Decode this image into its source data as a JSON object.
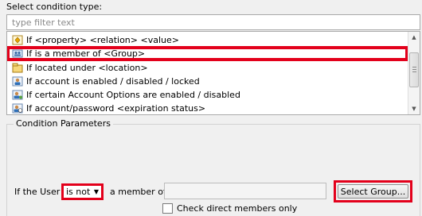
{
  "header": {
    "select_label": "Select condition type:"
  },
  "filter": {
    "placeholder": "type filter text"
  },
  "conditions": [
    {
      "label": "If <property> <relation> <value>",
      "icon": "property-condition-icon"
    },
    {
      "label": "If is a member of <Group>",
      "icon": "group-condition-icon",
      "selected": true
    },
    {
      "label": "If located under <location>",
      "icon": "location-condition-icon"
    },
    {
      "label": "If account is enabled / disabled / locked",
      "icon": "account-condition-icon"
    },
    {
      "label": "If certain Account Options are enabled / disabled",
      "icon": "account-options-condition-icon"
    },
    {
      "label": "If account/password <expiration status>",
      "icon": "expiration-condition-icon"
    }
  ],
  "params": {
    "title": "Condition Parameters",
    "if_user_label": "If the User",
    "relation_value": "is not",
    "member_of_label": "a member of",
    "group_value": "",
    "select_group_label": "Select Group...",
    "check_direct_label": "Check direct members only",
    "check_direct_checked": false
  },
  "colors": {
    "highlight": "#e3001b"
  }
}
